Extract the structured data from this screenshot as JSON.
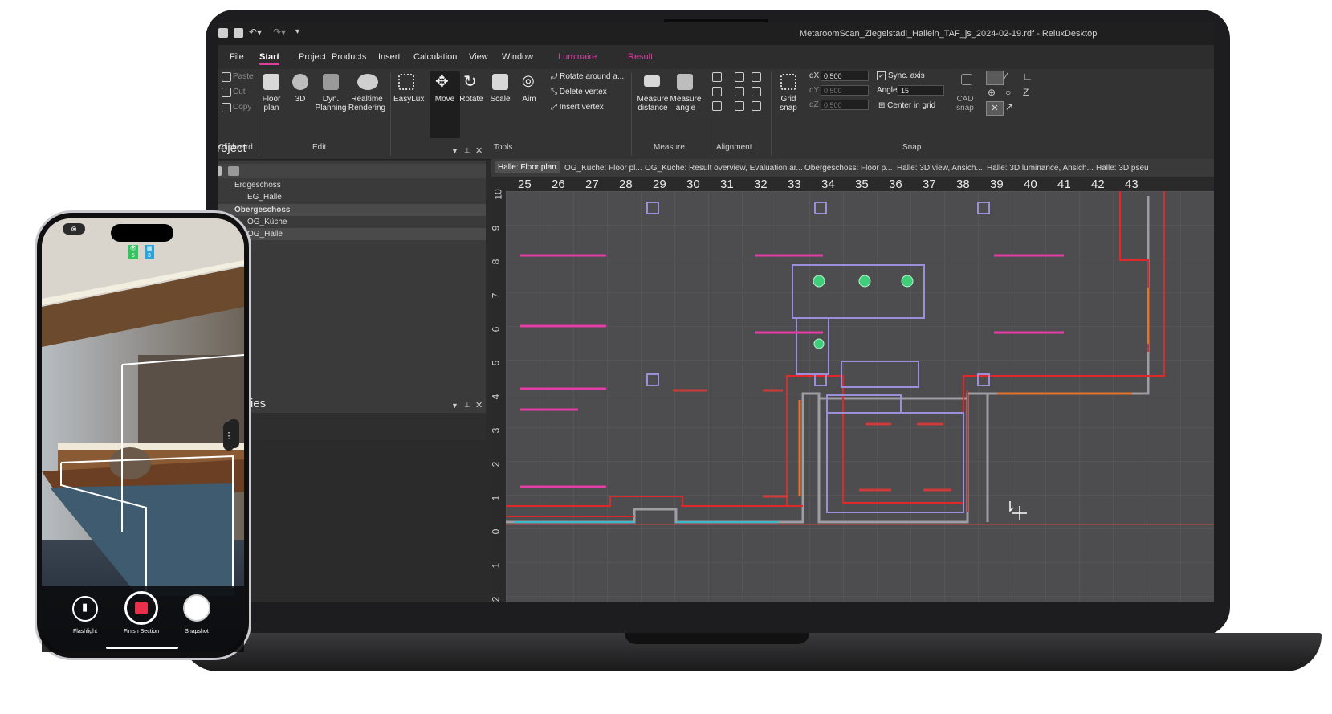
{
  "app": {
    "window_title": "MetaroomScan_Ziegelstadl_Hallein_TAF_js_2024-02-19.rdf - ReluxDesktop"
  },
  "menu": [
    "File",
    "Start",
    "Project",
    "Products",
    "Insert",
    "Calculation",
    "View",
    "Window",
    "Luminaire",
    "Result"
  ],
  "ribbon": {
    "clipboard": {
      "paste": "Paste",
      "cut": "Cut",
      "copy": "Copy",
      "group": "Clipboard"
    },
    "edit": {
      "floor_plan_1": "Floor",
      "floor_plan_2": "plan",
      "three_d": "3D",
      "dyn_1": "Dyn.",
      "dyn_2": "Planning",
      "realtime_1": "Realtime",
      "realtime_2": "Rendering",
      "group": "Edit"
    },
    "tools": {
      "easylux": "EasyLux",
      "move": "Move",
      "rotate": "Rotate",
      "scale": "Scale",
      "aim": "Aim",
      "rotate_around": "Rotate around a...",
      "delete_vertex": "Delete vertex",
      "insert_vertex": "Insert vertex",
      "group": "Tools"
    },
    "measure": {
      "dist_1": "Measure",
      "dist_2": "distance",
      "angle_1": "Measure",
      "angle_2": "angle",
      "group": "Measure"
    },
    "alignment": {
      "group": "Alignment"
    },
    "snap": {
      "grid_1": "Grid",
      "grid_2": "snap",
      "dx_label": "dX",
      "dx": "0.500",
      "dy_label": "dY",
      "dy": "0.500",
      "dz_label": "dZ",
      "dz": "0.500",
      "sync_axis": "Sync. axis",
      "angle_label": "Angle",
      "angle": "15",
      "center_in_grid": "Center in grid",
      "cad_1": "CAD",
      "cad_2": "snap",
      "group": "Snap"
    }
  },
  "project_panel": {
    "title": "Project",
    "tree": [
      {
        "label": "Erdgeschoss",
        "level": 0
      },
      {
        "label": "EG_Halle",
        "level": 1
      },
      {
        "label": "Obergeschoss",
        "level": 0
      },
      {
        "label": "OG_Küche",
        "level": 1
      },
      {
        "label": "OG_Halle",
        "level": 1
      }
    ],
    "second_title": "ies"
  },
  "tabs": [
    "Halle: Floor plan",
    "OG_Küche: Floor pl...",
    "OG_Küche: Result overview, Evaluation ar...",
    "Obergeschoss: Floor p...",
    "Halle: 3D view, Ansich...",
    "Halle: 3D luminance, Ansich...",
    "Halle: 3D pseu"
  ],
  "ruler_top": [
    "25",
    "26",
    "27",
    "28",
    "29",
    "30",
    "31",
    "32",
    "33",
    "34",
    "35",
    "36",
    "37",
    "38",
    "39",
    "40",
    "41",
    "42",
    "43"
  ],
  "ruler_left": [
    "10",
    "9",
    "8",
    "7",
    "6",
    "5",
    "4",
    "3",
    "2",
    "1",
    "0",
    "1",
    "2"
  ],
  "phone": {
    "badge_left": "5",
    "badge_right": "3",
    "flashlight": "Flashlight",
    "finish_section": "Finish Section",
    "snapshot": "Snapshot"
  },
  "colors": {
    "accent": "#e03ca0",
    "wall_red": "#e0282a",
    "luminaire_pink": "#e53da6",
    "plan_bg": "#4d4d4f"
  }
}
